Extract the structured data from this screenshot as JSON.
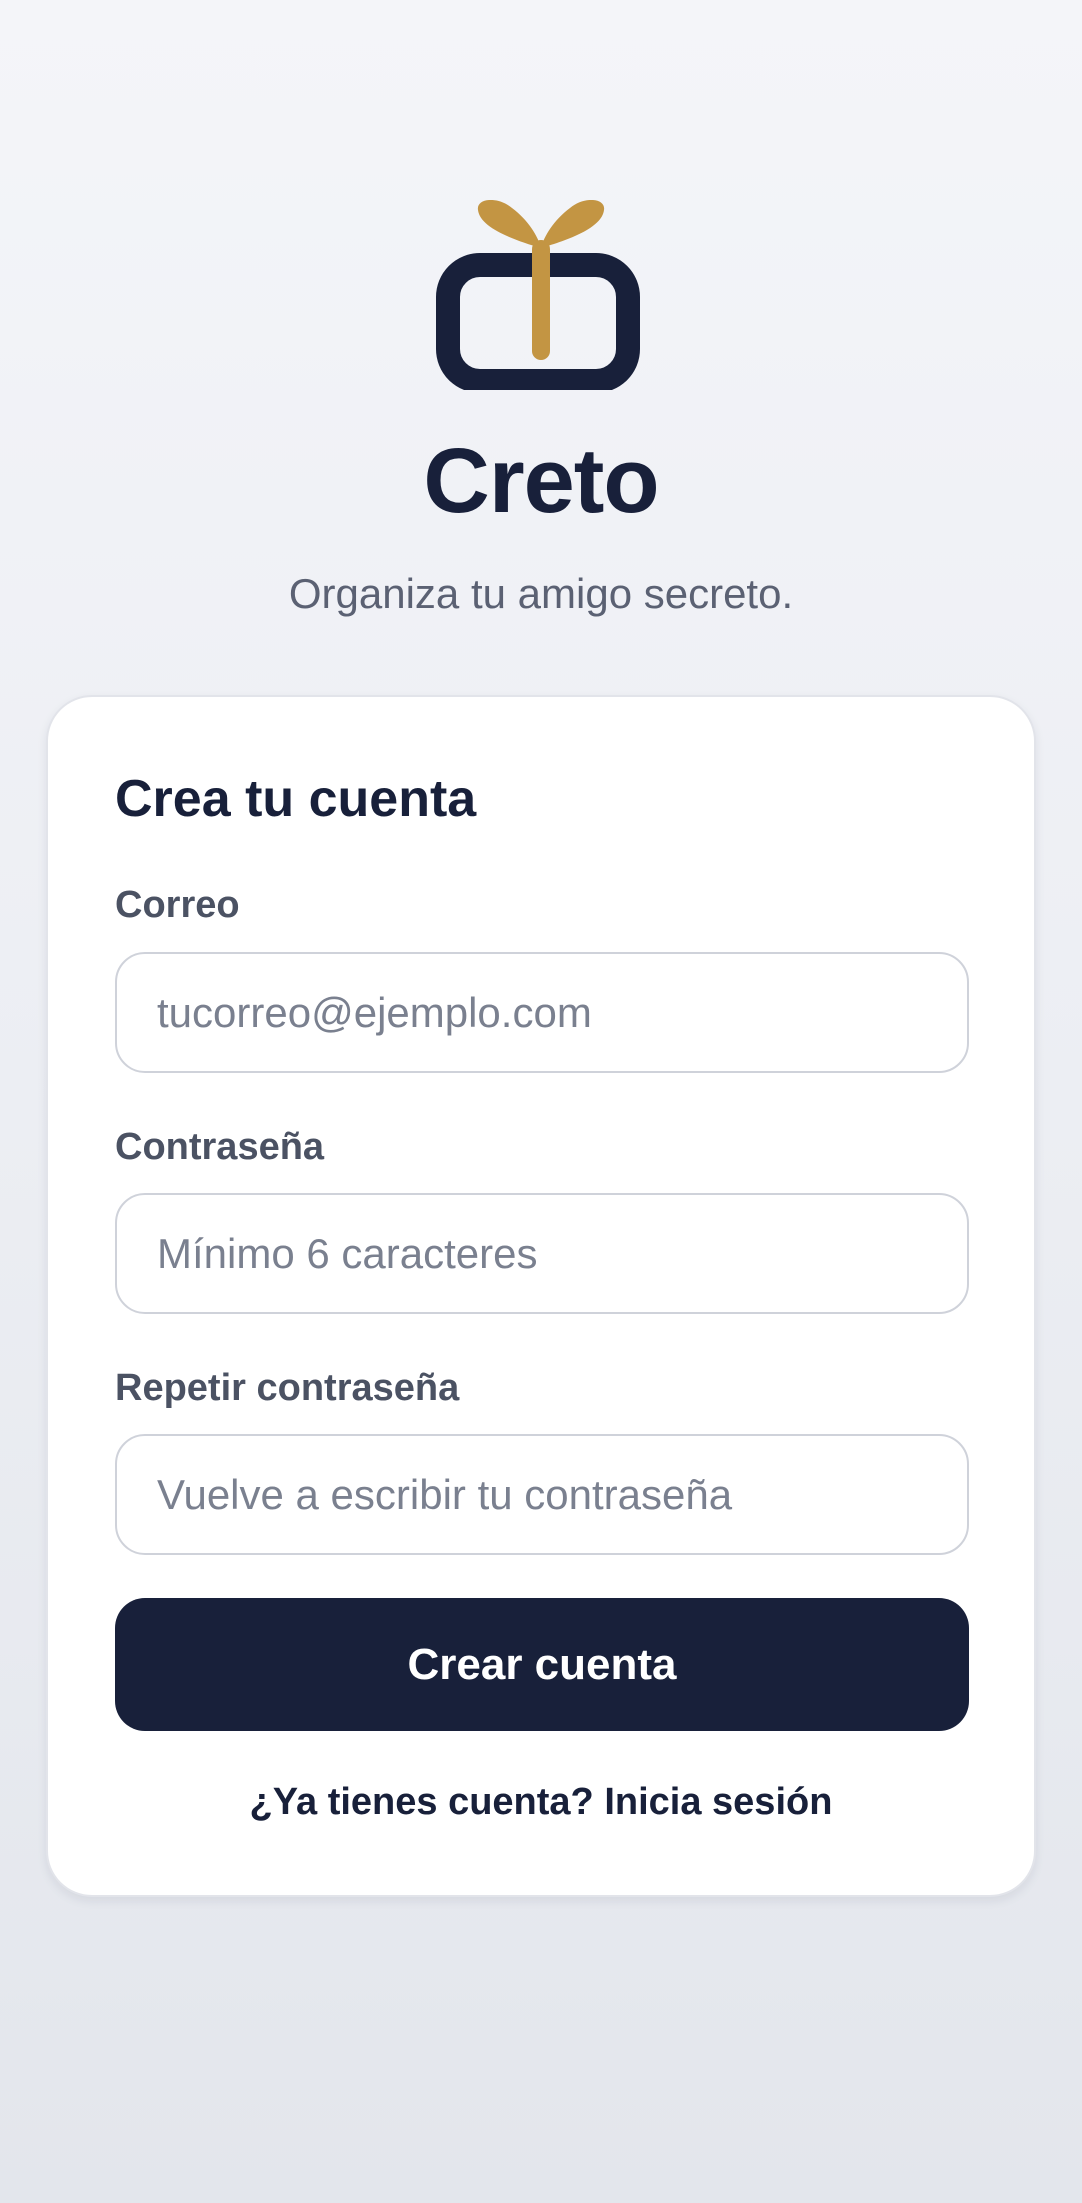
{
  "brand": {
    "logo_icon": "gift-box-icon",
    "name": "Creto",
    "tagline": "Organiza tu amigo secreto.",
    "colors": {
      "navy": "#18203a",
      "gold": "#c39543"
    }
  },
  "form": {
    "title": "Crea tu cuenta",
    "email": {
      "label": "Correo",
      "value": "",
      "placeholder": "tucorreo@ejemplo.com"
    },
    "password": {
      "label": "Contraseña",
      "value": "",
      "placeholder": "Mínimo 6 caracteres"
    },
    "confirm_password": {
      "label": "Repetir contraseña",
      "value": "",
      "placeholder": "Vuelve a escribir tu contraseña"
    },
    "submit_label": "Crear cuenta",
    "login_link": "¿Ya tienes cuenta? Inicia sesión"
  }
}
